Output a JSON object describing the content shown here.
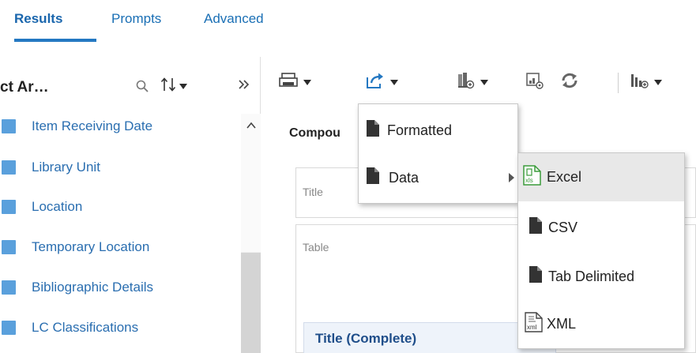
{
  "tabs": [
    {
      "label": "Results",
      "active": true
    },
    {
      "label": "Prompts",
      "active": false
    },
    {
      "label": "Advanced",
      "active": false
    }
  ],
  "subject_area": {
    "title": "ct Ar…",
    "tree_items": [
      {
        "label": "Item Receiving Date"
      },
      {
        "label": "Library Unit"
      },
      {
        "label": "Location"
      },
      {
        "label": "Temporary Location"
      },
      {
        "label": "Bibliographic Details"
      },
      {
        "label": "LC Classifications"
      }
    ]
  },
  "toolbar": {
    "icons": [
      "print-icon",
      "export-icon",
      "library-icon",
      "catalog-icon",
      "refresh-icon",
      "chart-icon"
    ]
  },
  "compound_layout": {
    "title": "Compou",
    "views": [
      {
        "label": "Title"
      },
      {
        "label": "Table"
      }
    ],
    "table_header": "Title (Complete)"
  },
  "export_menu": {
    "items": [
      {
        "label": "Formatted",
        "icon": "document-icon"
      },
      {
        "label": "Data",
        "icon": "document-icon",
        "has_submenu": true
      }
    ]
  },
  "data_submenu": {
    "items": [
      {
        "label": "Excel",
        "icon": "excel-icon",
        "highlighted": true
      },
      {
        "label": "CSV",
        "icon": "document-icon"
      },
      {
        "label": "Tab Delimited",
        "icon": "document-icon"
      },
      {
        "label": "XML",
        "icon": "xml-icon"
      }
    ]
  },
  "colors": {
    "accent": "#2478c2",
    "link": "#2a6eb0",
    "folder": "#5aa0dc",
    "excel_green": "#3a9b3a"
  }
}
